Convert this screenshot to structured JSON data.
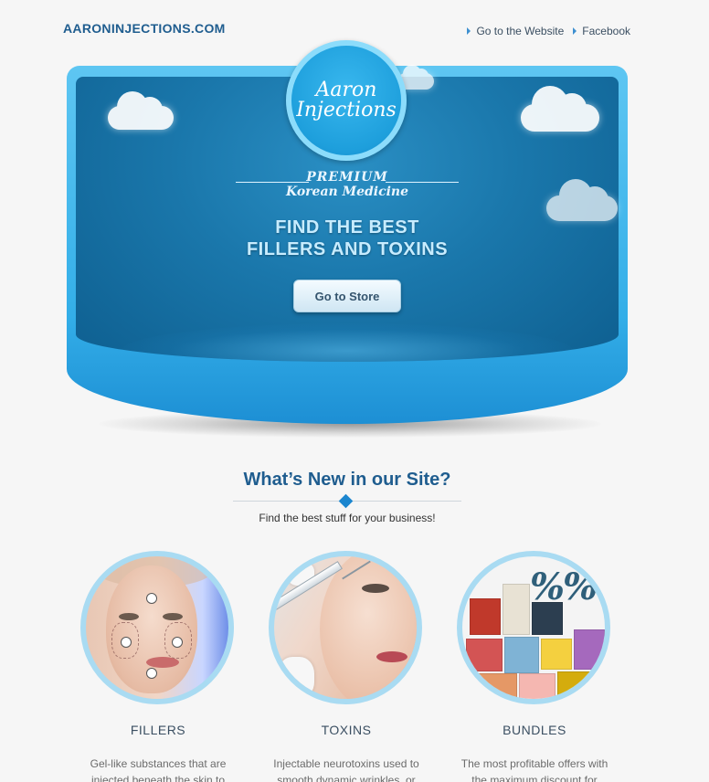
{
  "header": {
    "brand": "AARONINJECTIONS.COM",
    "links": [
      {
        "label": "Go to the Website"
      },
      {
        "label": "Facebook"
      }
    ]
  },
  "hero": {
    "logo_line1": "Aaron",
    "logo_line2": "Injections",
    "premium_line1": "PREMIUM",
    "premium_line2": "Korean Medicine",
    "headline_line1": "FIND THE BEST",
    "headline_line2": "FILLERS AND TOXINS",
    "button_label": "Go to Store"
  },
  "section": {
    "title": "What’s New in our Site?",
    "subtitle": "Find the best stuff for your business!"
  },
  "cards": [
    {
      "title": "FILLERS",
      "desc": "Gel-like substances that are injected beneath the skin to"
    },
    {
      "title": "TOXINS",
      "desc": "Injectable neurotoxins used to smooth dynamic wrinkles, or"
    },
    {
      "title": "BUNDLES",
      "desc": "The most profitable offers with the maximum discount for"
    }
  ],
  "colors": {
    "brand": "#1f5d8f",
    "hero_blue": "#1a77ab",
    "frame_blue": "#33aee8",
    "accent": "#1b86cf"
  },
  "icons": {
    "link_bullet": "triangle-right",
    "divider": "diamond"
  }
}
